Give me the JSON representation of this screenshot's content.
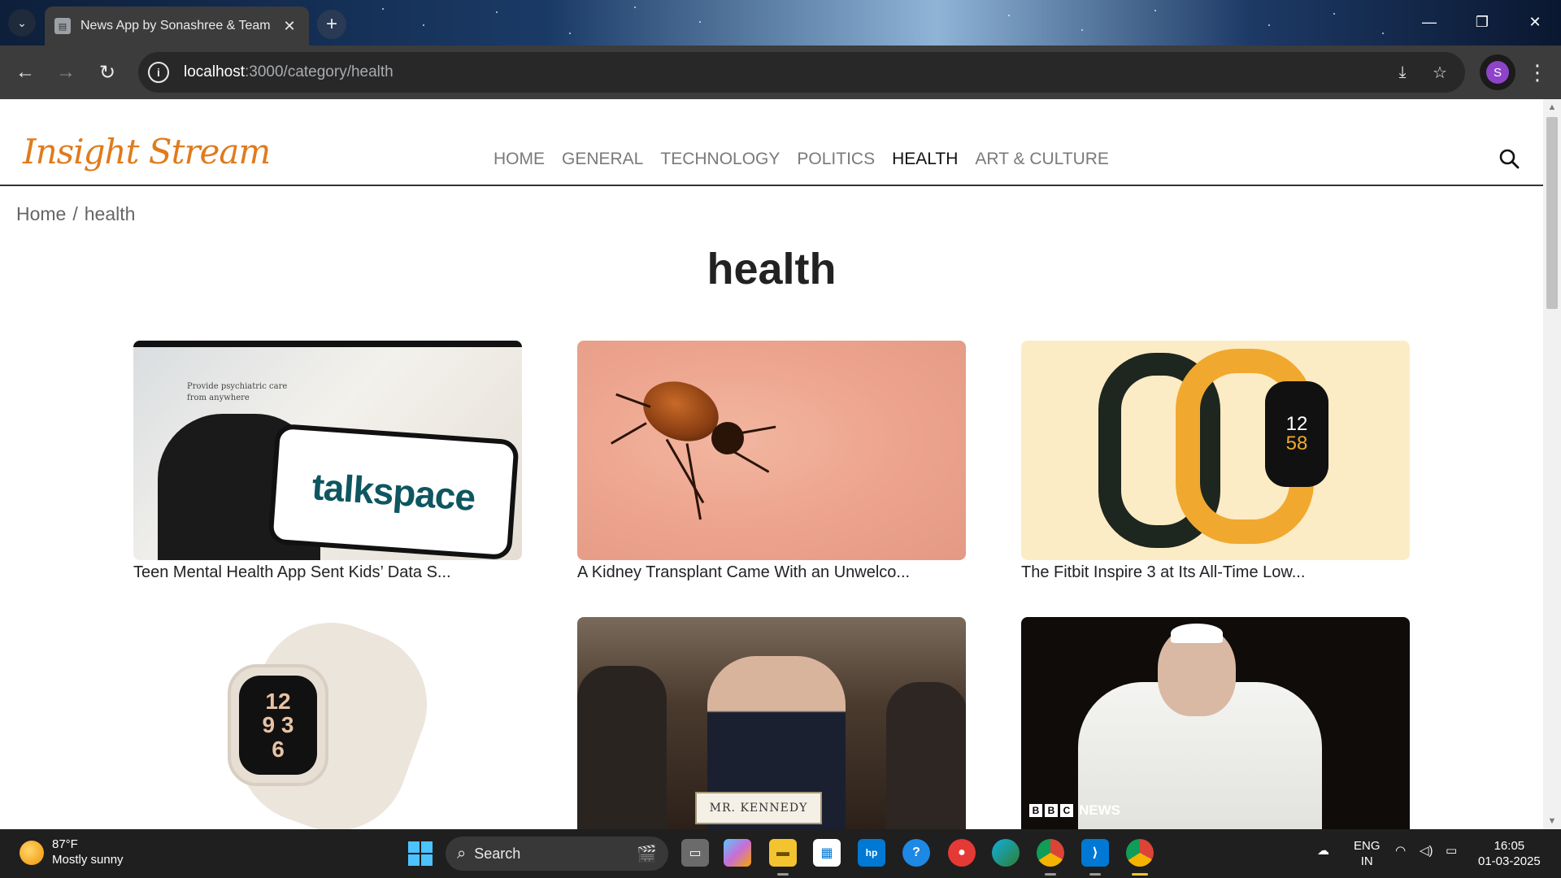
{
  "browser": {
    "tab_title": "News App by Sonashree & Team",
    "url_host": "localhost",
    "url_path": ":3000/category/health",
    "profile_initial": "S"
  },
  "site": {
    "logo_text": "Insight Stream",
    "nav": [
      {
        "label": "HOME"
      },
      {
        "label": "GENERAL"
      },
      {
        "label": "TECHNOLOGY"
      },
      {
        "label": "POLITICS"
      },
      {
        "label": "HEALTH",
        "active": true
      },
      {
        "label": "ART & CULTURE"
      }
    ],
    "breadcrumb": {
      "home": "Home",
      "sep": "/",
      "current": "health"
    },
    "page_title": "health",
    "articles": [
      {
        "caption": "Teen Mental Health App Sent Kids’ Data S...",
        "image": "talkspace-phone",
        "image_text": "talkspace",
        "image_headline": "Provide psychiatric care from anywhere"
      },
      {
        "caption": "A Kidney Transplant Came With an Unwelco...",
        "image": "tick-on-skin"
      },
      {
        "caption": "The Fitbit Inspire 3 at Its All-Time Low...",
        "image": "fitbit-bands",
        "image_time_hours": "12",
        "image_time_minutes": "58"
      },
      {
        "caption": "",
        "image": "apple-watch",
        "image_numbers": [
          "12",
          "9 3",
          "6"
        ]
      },
      {
        "caption": "",
        "image": "senate-hearing",
        "image_text": "MR. KENNEDY"
      },
      {
        "caption": "",
        "image": "pope-bbc",
        "image_text": "NEWS"
      }
    ]
  },
  "taskbar": {
    "weather_temp": "87°F",
    "weather_desc": "Mostly sunny",
    "search_label": "Search",
    "lang_top": "ENG",
    "lang_bottom": "IN",
    "time": "16:05",
    "date": "01-03-2025"
  },
  "colors": {
    "logo": "#e07b1c",
    "nav_active": "#111111",
    "nav_inactive": "#7a7a7a",
    "chrome_dark": "#3c3c3c"
  }
}
